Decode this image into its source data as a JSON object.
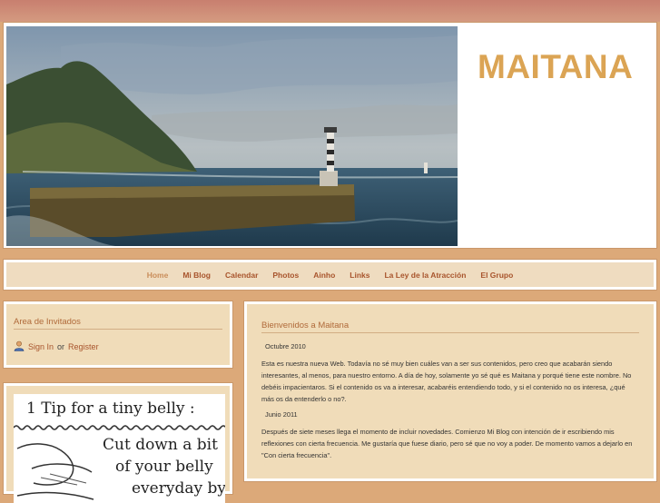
{
  "site": {
    "title": "MAITANA"
  },
  "nav": {
    "items": [
      {
        "label": "Home"
      },
      {
        "label": "Mi Blog"
      },
      {
        "label": "Calendar"
      },
      {
        "label": "Photos"
      },
      {
        "label": "Ainho"
      },
      {
        "label": "Links"
      },
      {
        "label": "La Ley de la Atracción"
      },
      {
        "label": "El Grupo"
      }
    ]
  },
  "guest_area": {
    "title": "Area de Invitados",
    "sign_in": "Sign In",
    "or": "or",
    "register": "Register"
  },
  "promo": {
    "line1": "1 Tip for a tiny belly :",
    "line2": "Cut down a bit",
    "line3": "of your belly",
    "line4": "everyday by"
  },
  "welcome": {
    "title": "Bienvenidos a Maitana",
    "date1": "Octubre 2010",
    "para1": "Esta es nuestra nueva Web. Todavía no sé muy bien cuáles van a ser sus contenidos, pero creo que acabarán siendo interesantes, al menos, para nuestro entorno. A día de hoy, solamente yo sé qué es Maitana y porqué tiene este nombre. No debéis impacientaros. Si el contenido os va a interesar, acabaréis entendiendo todo, y si el contenido no os interesa, ¿qué más os da entenderlo o no?.",
    "date2": "Junio 2011",
    "para2": "Después de siete meses llega el momento de incluir novedades. Comienzo Mi Blog con intención de ir escribiendo mis reflexiones con cierta frecuencia. Me gustaría que fuese diario, pero sé que no voy a poder. De momento vamos a dejarlo en \"Con cierta frecuencia\"."
  },
  "colors": {
    "accent": "#dba454",
    "link": "#a8542c",
    "panel": "#f0dcb9",
    "background": "#dca979"
  }
}
